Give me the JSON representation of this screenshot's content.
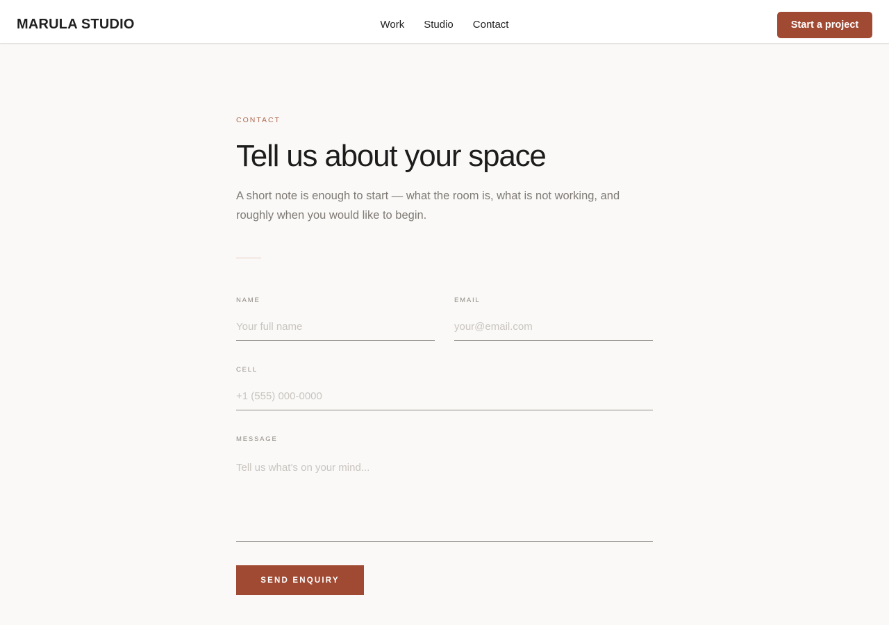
{
  "header": {
    "logo": "MARULA STUDIO",
    "nav": [
      {
        "label": "Work"
      },
      {
        "label": "Studio"
      },
      {
        "label": "Contact"
      }
    ],
    "cta_label": "Start a project"
  },
  "contact": {
    "eyebrow": "CONTACT",
    "title": "Tell us about your space",
    "lede": "A short note is enough to start — what the room is, what is not working, and roughly when you would like to begin."
  },
  "form": {
    "name": {
      "label": "NAME",
      "placeholder": "Your full name",
      "value": ""
    },
    "email": {
      "label": "EMAIL",
      "placeholder": "your@email.com",
      "value": ""
    },
    "cell": {
      "label": "CELL",
      "placeholder": "+1 (555) 000-0000",
      "value": ""
    },
    "message": {
      "label": "MESSAGE",
      "placeholder": "Tell us what’s on your mind...",
      "value": ""
    },
    "submit_label": "SEND ENQUIRY"
  },
  "colors": {
    "accent": "#a14a33",
    "background": "#faf9f7",
    "eyebrow": "#b06a52"
  }
}
